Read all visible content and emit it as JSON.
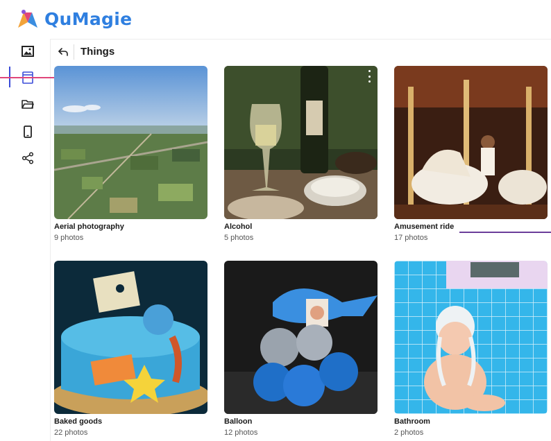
{
  "app": {
    "name": "QuMagie"
  },
  "sidebar": {
    "items": [
      {
        "name": "photos",
        "icon": "image-icon"
      },
      {
        "name": "albums",
        "icon": "album-icon",
        "active": true
      },
      {
        "name": "folders",
        "icon": "folder-icon"
      },
      {
        "name": "device",
        "icon": "phone-icon"
      },
      {
        "name": "share",
        "icon": "share-icon"
      }
    ]
  },
  "header": {
    "title": "Things",
    "back_icon": "back-arrow-icon"
  },
  "cards": [
    {
      "title": "Aerial photography",
      "count": "9 photos"
    },
    {
      "title": "Alcohol",
      "count": "5 photos",
      "menu_icon": "more-vertical-icon"
    },
    {
      "title": "Amusement ride",
      "count": "17 photos"
    },
    {
      "title": "Baked goods",
      "count": "22 photos"
    },
    {
      "title": "Balloon",
      "count": "12 photos"
    },
    {
      "title": "Bathroom",
      "count": "2 photos"
    }
  ],
  "colors": {
    "brand": "#2f7fe0",
    "active_marker": "#3a4bd8"
  }
}
